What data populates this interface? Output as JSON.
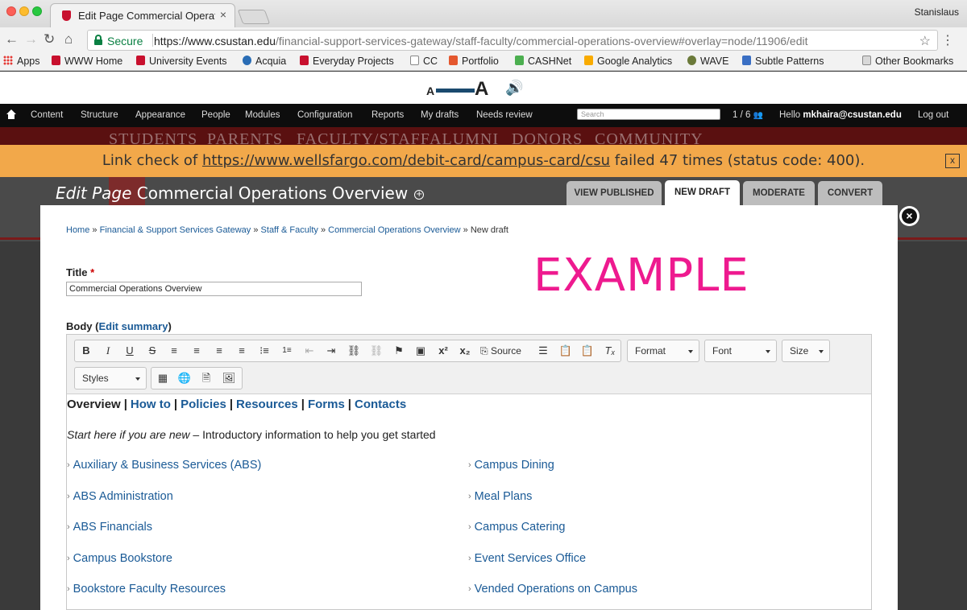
{
  "browser": {
    "tab_title": "Edit Page Commercial Operati",
    "tab_close": "×",
    "profile": "Stanislaus",
    "secure_label": "Secure",
    "url_scheme": "https://",
    "url_host": "www.csustan.edu",
    "url_path": "/financial-support-services-gateway/staff-faculty/commercial-operations-overview#overlay=node/11906/edit",
    "bookmarks": [
      "Apps",
      "WWW Home",
      "University Events",
      "Acquia",
      "Everyday Projects",
      "CC",
      "Portfolio",
      "CASHNet",
      "Google Analytics",
      "WAVE",
      "Subtle Patterns",
      "Other Bookmarks"
    ]
  },
  "a11y": {
    "small": "A",
    "big": "A"
  },
  "admin": {
    "links": [
      "Content",
      "Structure",
      "Appearance",
      "People",
      "Modules",
      "Configuration",
      "Reports",
      "My drafts",
      "Needs review"
    ],
    "search_placeholder": "Search",
    "count": "1 / 6",
    "hello_prefix": "Hello",
    "user": "mkhaira@csustan.edu",
    "logout": "Log out"
  },
  "background_nav": [
    "STUDENTS",
    "PARENTS",
    "FACULTY/STAFF",
    "ALUMNI",
    "DONORS",
    "COMMUNITY"
  ],
  "warning": {
    "prefix": "Link check of",
    "link": "https://www.wellsfargo.com/debit-card/campus-card/csu",
    "suffix": "failed 47 times (status code: 400).",
    "close": "x"
  },
  "overlay": {
    "title_italic": "Edit Page",
    "title": "Commercial Operations Overview",
    "tabs": [
      "VIEW PUBLISHED",
      "NEW DRAFT",
      "MODERATE",
      "CONVERT"
    ],
    "active_tab": "NEW DRAFT"
  },
  "form": {
    "breadcrumb": [
      "Home",
      "Financial & Support Services Gateway",
      "Staff & Faculty",
      "Commercial Operations Overview"
    ],
    "breadcrumb_current": "New draft",
    "breadcrumb_sep": "»",
    "watermark": "EXAMPLE",
    "title_label": "Title",
    "required_mark": "*",
    "title_value": "Commercial Operations Overview",
    "body_label": "Body",
    "edit_summary": "Edit summary"
  },
  "editor": {
    "source_label": "Source",
    "format_label": "Format",
    "font_label": "Font",
    "size_label": "Size",
    "styles_label": "Styles",
    "content_nav": {
      "current": "Overview",
      "links": [
        "How to",
        "Policies",
        "Resources",
        "Forms",
        "Contacts"
      ]
    },
    "intro_italic": "Start here if you are new",
    "intro_rest": " – Introductory information to help you get started",
    "left_links": [
      "Auxiliary & Business Services (ABS)",
      "ABS Administration",
      "ABS Financials",
      "Campus Bookstore",
      "Bookstore Faculty Resources"
    ],
    "right_links": [
      "Campus Dining",
      "Meal Plans",
      "Campus Catering",
      "Event Services Office",
      "Vended Operations on Campus"
    ]
  },
  "colors": {
    "warning_bg": "#f2a84a",
    "admin_bg": "#0d0d0d",
    "watermark": "#ee1a8f",
    "link": "#1a5a96"
  }
}
